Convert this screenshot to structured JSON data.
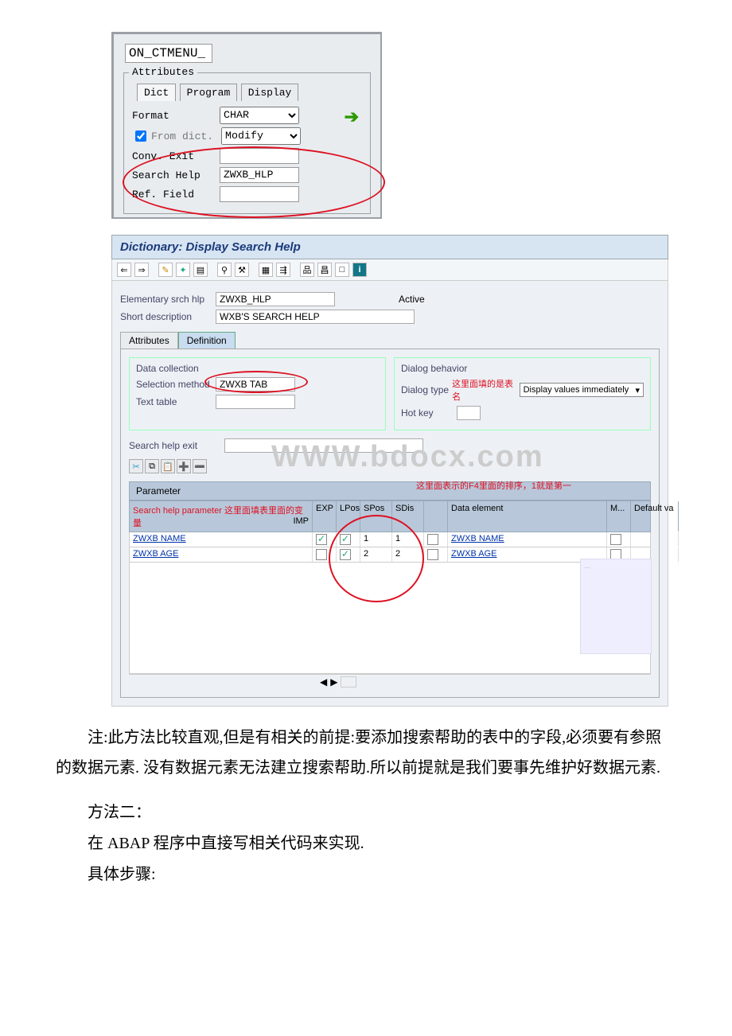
{
  "upper": {
    "fn_name": "ON_CTMENU_",
    "attributes_legend": "Attributes",
    "tabs": {
      "dict": "Dict",
      "program": "Program",
      "display": "Display"
    },
    "format_label": "Format",
    "format_value": "CHAR",
    "from_dict_label": "From dict.",
    "from_dict_value": "Modify",
    "conv_exit_label": "Conv. Exit",
    "search_help_label": "Search Help",
    "search_help_value": "ZWXB_HLP",
    "ref_field_label": "Ref. Field"
  },
  "lower": {
    "title": "Dictionary: Display Search Help",
    "elem_label": "Elementary srch hlp",
    "elem_value": "ZWXB_HLP",
    "active_label": "Active",
    "shortdesc_label": "Short description",
    "shortdesc_value": "WXB'S SEARCH HELP",
    "tabs": {
      "attributes": "Attributes",
      "definition": "Definition"
    },
    "datacollection_title": "Data collection",
    "selection_method_label": "Selection method",
    "selection_method_value": "ZWXB TAB",
    "selection_method_note": "这里面填的是表名",
    "text_table_label": "Text table",
    "srch_exit_label": "Search help exit",
    "dialog_title": "Dialog behavior",
    "dialog_type_label": "Dialog type",
    "dialog_type_value": "Display values immediately",
    "hotkey_label": "Hot key",
    "watermark": "WWW.bdocx.com",
    "parameter_header": "Parameter",
    "param_note_top": "这里面表示的F4里面的排序，1就是第一",
    "param_note_left": "Search help parameter 这里面填表里面的变量",
    "cols": {
      "imp": "IMP",
      "exp": "EXP",
      "lpos": "LPos",
      "spos": "SPos",
      "sdis": "SDis",
      "de": "Data element",
      "m": "M...",
      "dv": "Default va"
    },
    "rows": [
      {
        "name": "ZWXB NAME",
        "imp": true,
        "exp": true,
        "lpos": "1",
        "spos": "1",
        "sdis": false,
        "de": "ZWXB NAME",
        "m": false,
        "dv": ""
      },
      {
        "name": "ZWXB AGE",
        "imp": false,
        "exp": true,
        "lpos": "2",
        "spos": "2",
        "sdis": false,
        "de": "ZWXB AGE",
        "m": false,
        "dv": ""
      }
    ]
  },
  "text": {
    "p1": "注:此方法比较直观,但是有相关的前提:要添加搜索帮助的表中的字段,必须要有参照的数据元素. 没有数据元素无法建立搜索帮助.所以前提就是我们要事先维护好数据元素.",
    "p2": "方法二：",
    "p3": "在 ABAP 程序中直接写相关代码来实现.",
    "p4": "具体步骤:"
  }
}
